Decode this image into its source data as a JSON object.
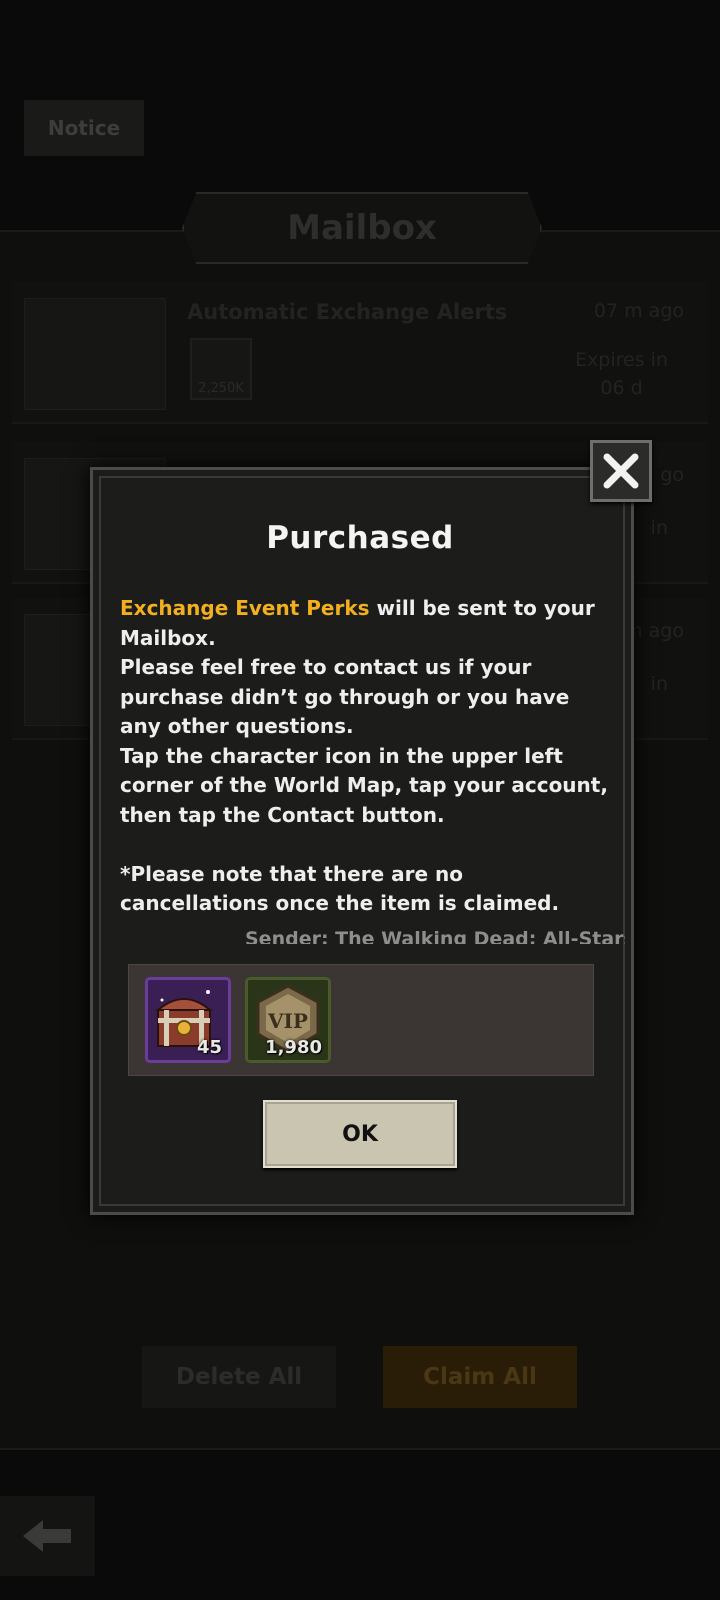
{
  "background": {
    "notice_tab": "Notice",
    "title": "Mailbox",
    "mails": [
      {
        "subject": "Automatic Exchange Alerts",
        "time": "07 m ago",
        "expires": "Expires in\n06 d",
        "item_count": "2,250K"
      },
      {
        "subject": "",
        "time": "go",
        "expires": "in"
      },
      {
        "subject": "",
        "time": "m ago",
        "expires": "in"
      }
    ],
    "delete_all_label": "Delete All",
    "claim_all_label": "Claim All"
  },
  "modal": {
    "title": "Purchased",
    "highlight": "Exchange Event Perks",
    "line1_rest": " will be sent to your Mailbox.",
    "line2": "Please feel free to contact us if your purchase didn’t go through or you have any other questions.",
    "line3": "Tap the character icon in the upper left corner of the World Map, tap your account, then tap the Contact button.",
    "note": "*Please note that there are no cancellations once the item is claimed.",
    "sender": "Sender: The Walking Dead: All-Stars",
    "rewards": [
      {
        "icon": "treasure-chest-icon",
        "count": "45"
      },
      {
        "icon": "vip-badge-icon",
        "count": "1,980"
      }
    ],
    "ok_label": "OK"
  },
  "colors": {
    "highlight": "#f2b01e",
    "modal_bg": "#1c1c1b",
    "ok_button": "#c9c5b1"
  }
}
